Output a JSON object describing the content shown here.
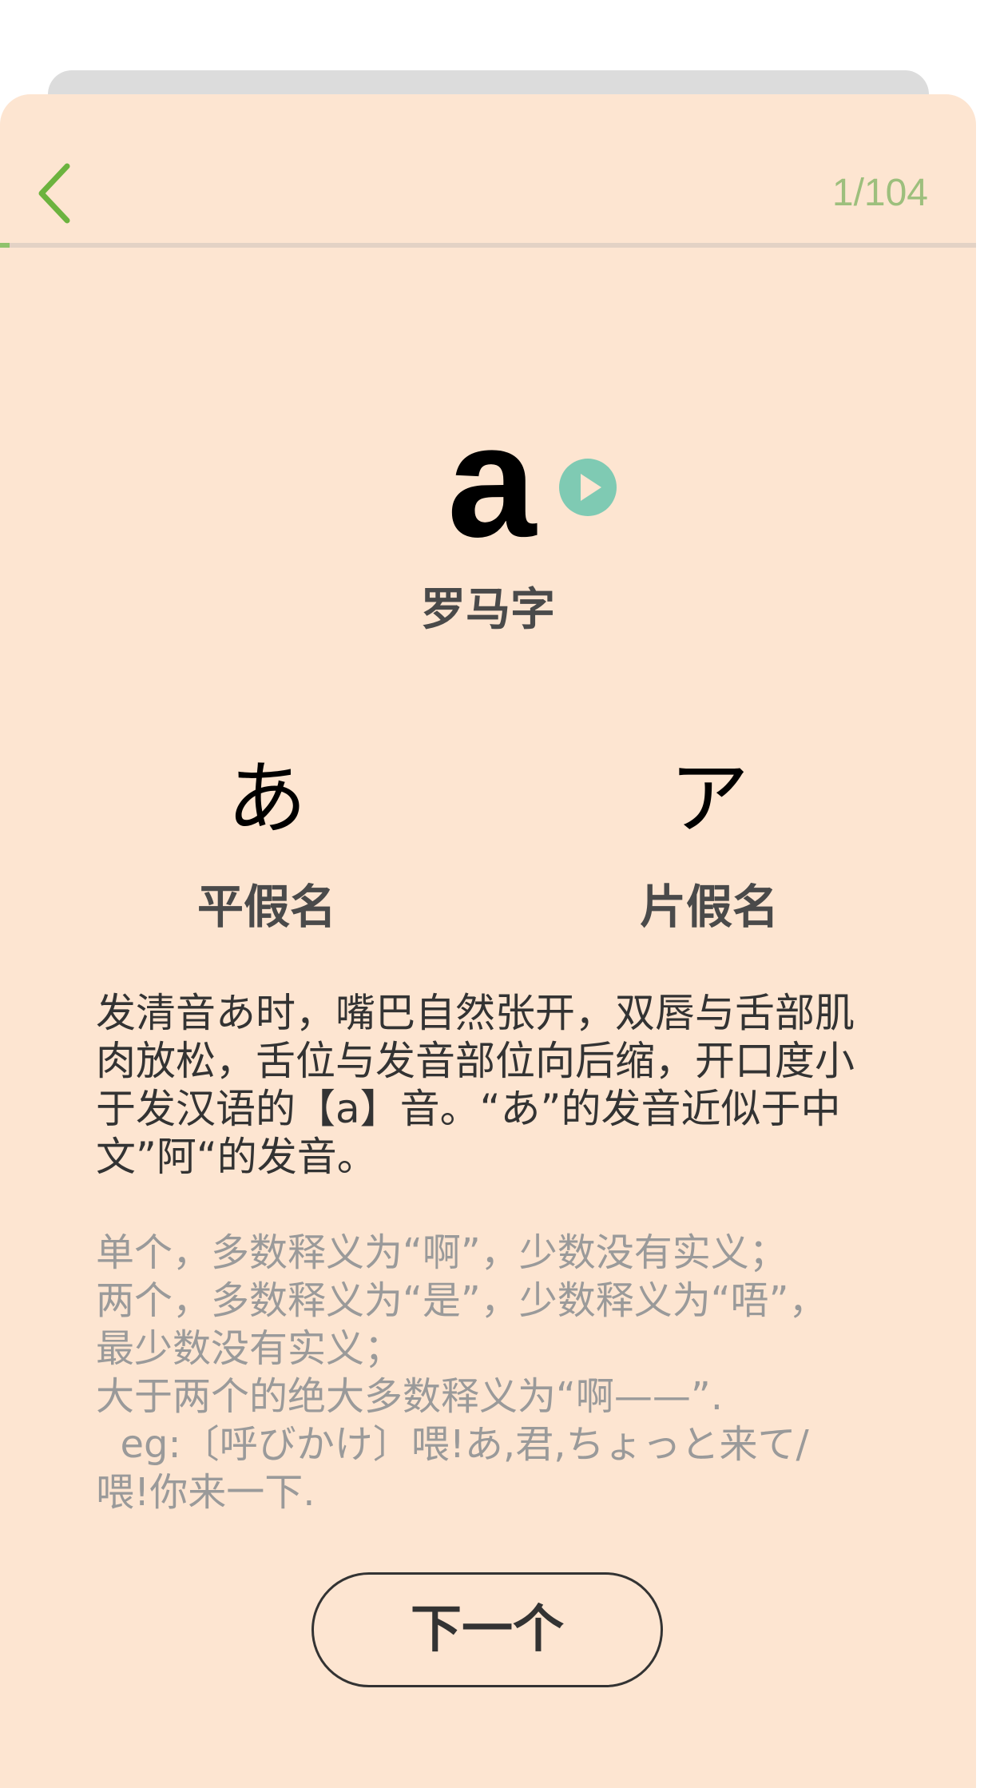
{
  "header": {
    "counter": "1/104",
    "progress_fraction": 0.0096
  },
  "main": {
    "romaji": "a",
    "romaji_label": "罗马字",
    "hiragana": "あ",
    "hiragana_label": "平假名",
    "katakana": "ア",
    "katakana_label": "片假名",
    "description": "发清音あ时，嘴巴自然张开，双唇与舌部肌肉放松，舌位与发音部位向后缩，开口度小于发汉语的【a】音。“あ”的发音近似于中文”阿“的发音。",
    "meaning_lines": [
      "单个，多数释义为“啊”，少数没有实义；",
      "两个，多数释义为“是”，少数释义为“唔”，",
      "最少数没有实义；",
      "大于两个的绝大多数释义为“啊——”.",
      "  eg:〔呼びかけ〕喂!あ,君,ちょっと来て/",
      "喂!你来一下."
    ],
    "next_label": "下一个"
  },
  "colors": {
    "card_background": "#fde5d1",
    "accent_green": "#6cb33f",
    "counter_green": "#9dbf7d",
    "play_teal": "#7fcab3"
  },
  "icons": {
    "back": "chevron-left-icon",
    "play": "play-icon"
  }
}
